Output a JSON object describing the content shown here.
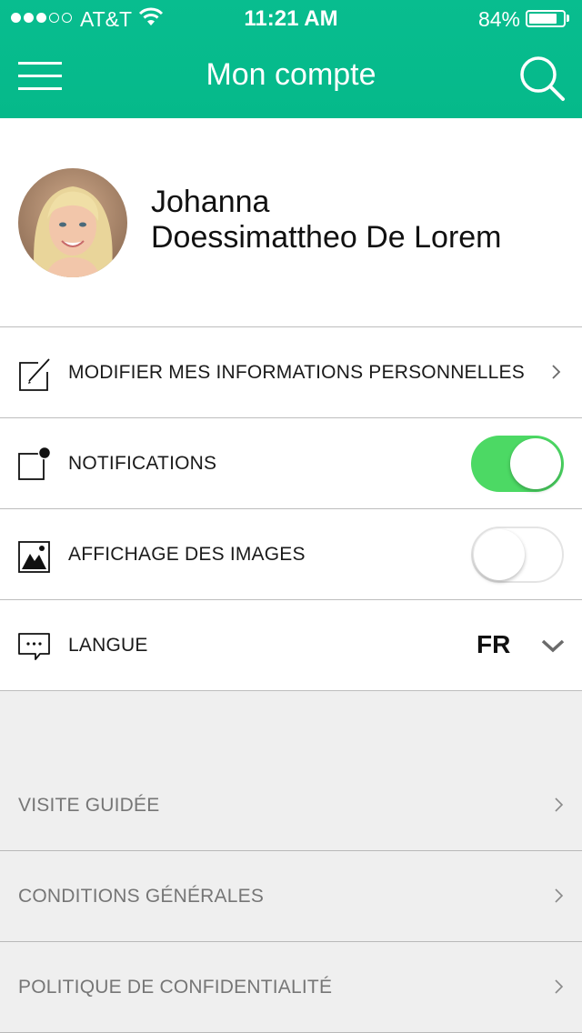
{
  "status_bar": {
    "carrier": "AT&T",
    "time": "11:21 AM",
    "battery_percent_text": "84%",
    "battery_level": 0.84,
    "signal_bars_filled": 3,
    "signal_bars_total": 5
  },
  "header": {
    "title": "Mon compte",
    "background_color": "#06bb8c",
    "menu_icon": "hamburger-menu-icon",
    "search_icon": "search-icon"
  },
  "profile": {
    "first_name": "Johanna",
    "last_name": "Doessimattheo De Lorem"
  },
  "settings": {
    "edit_info": {
      "label": "MODIFIER MES INFORMATIONS PERSONNELLES",
      "icon": "edit-icon"
    },
    "notifications": {
      "label": "NOTIFICATIONS",
      "icon": "notification-icon",
      "enabled": true
    },
    "images": {
      "label": "AFFICHAGE DES IMAGES",
      "icon": "image-icon",
      "enabled": false
    },
    "language": {
      "label": "LANGUE",
      "icon": "chat-bubble-icon",
      "value": "FR"
    }
  },
  "footer_links": [
    {
      "label": "VISITE GUIDÉE"
    },
    {
      "label": "CONDITIONS GÉNÉRALES"
    },
    {
      "label": "POLITIQUE DE CONFIDENTIALITÉ"
    }
  ],
  "colors": {
    "accent": "#06bb8c",
    "toggle_on": "#4cd964",
    "footer_background": "#efefef",
    "footer_text": "#767676"
  }
}
